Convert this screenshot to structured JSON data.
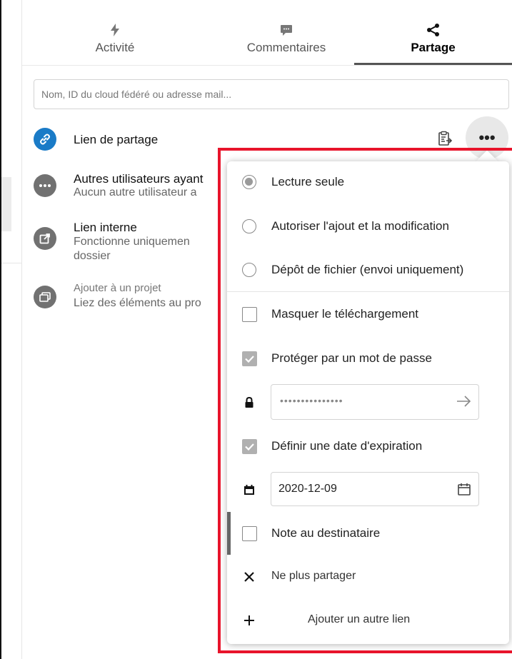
{
  "tabs": [
    {
      "label": "Activité",
      "icon": "activity-bolt-icon"
    },
    {
      "label": "Commentaires",
      "icon": "comment-bubble-icon"
    },
    {
      "label": "Partage",
      "icon": "share-icon",
      "active": true
    }
  ],
  "search": {
    "placeholder": "Nom, ID du cloud fédéré ou adresse mail..."
  },
  "shares": {
    "link": {
      "title": "Lien de partage"
    },
    "others": {
      "title": "Autres utilisateurs ayant",
      "subtitle": "Aucun autre utilisateur a"
    },
    "internal": {
      "title": "Lien interne",
      "subtitle_line1": "Fonctionne uniquemen",
      "subtitle_line2": "dossier"
    },
    "project": {
      "title": "Ajouter à un projet",
      "subtitle": "Liez des éléments au pro"
    }
  },
  "menu": {
    "permissions": [
      {
        "label": "Lecture seule",
        "selected": true
      },
      {
        "label": "Autoriser l'ajout et la modification",
        "selected": false
      },
      {
        "label": "Dépôt de fichier (envoi uniquement)",
        "selected": false
      }
    ],
    "hide_download": {
      "label": "Masquer le téléchargement",
      "checked": false
    },
    "password_protect": {
      "label": "Protéger par un mot de passe",
      "checked": true
    },
    "password_value": "•••••••••••••••",
    "expiration": {
      "label": "Définir une date d'expiration",
      "checked": true
    },
    "expiration_date": "2020-12-09",
    "note": {
      "label": "Note au destinataire",
      "checked": false
    },
    "unshare": {
      "label": "Ne plus partager"
    },
    "add_link": {
      "label": "Ajouter un autre lien"
    }
  },
  "colors": {
    "accent_link": "#1a7bc7",
    "highlight_frame": "#e8142b",
    "avatar_grey": "#717171"
  }
}
